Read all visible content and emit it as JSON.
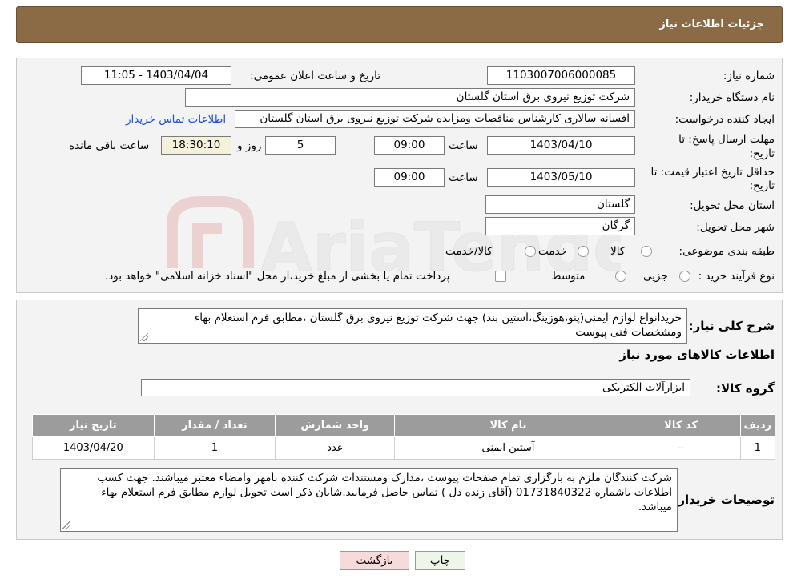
{
  "page_title": "جزئیات اطلاعات نیاز",
  "form": {
    "need_number_label": "شماره نیاز:",
    "need_number": "1103007006000085",
    "announce_label": "تاریخ و ساعت اعلان عمومی:",
    "announce_value": "1403/04/04 - 11:05",
    "buyer_org_label": "نام دستگاه خریدار:",
    "buyer_org": "شرکت توزیع نیروی برق استان گلستان",
    "creator_label": "ایجاد کننده درخواست:",
    "creator": "افسانه سالاری کارشناس مناقصات ومزایده شرکت توزیع نیروی برق استان گلستان",
    "contact_link": "اطلاعات تماس خریدار",
    "deadline_label_1": "مهلت ارسال پاسخ: تا",
    "deadline_label_2": "تاریخ:",
    "deadline_date": "1403/04/10",
    "time_label": "ساعت",
    "deadline_time": "09:00",
    "days_value": "5",
    "days_label": "روز و",
    "remaining_time": "18:30:10",
    "remaining_label": "ساعت باقی مانده",
    "validity_label_1": "حداقل تاریخ اعتبار قیمت: تا",
    "validity_label_2": "تاریخ:",
    "validity_date": "1403/05/10",
    "validity_time": "09:00",
    "province_label": "استان محل تحویل:",
    "province": "گلستان",
    "city_label": "شهر محل تحویل:",
    "city": "گرگان",
    "category_label": "طبقه بندی موضوعی:",
    "category_options": [
      "کالا",
      "خدمت",
      "کالا/خدمت"
    ],
    "purchase_type_label": "نوع فرآیند خرید :",
    "purchase_options": [
      "جزیی",
      "متوسط"
    ],
    "purchase_note": "پرداخت تمام یا بخشی از مبلغ خرید،از محل \"اسناد خزانه اسلامی\" خواهد بود."
  },
  "description": {
    "label": "شرح کلی نیاز:",
    "text": "خریدانواع لوازم ایمنی(پتو،هوزینگ،آستین بند) جهت شرکت توزیع نیروی برق گلستان ،مطابق فرم استعلام بهاء ومشخصات فنی پیوست"
  },
  "goods_section_title": "اطلاعات کالاهای مورد نیاز",
  "goods_group_label": "گروه کالا:",
  "goods_group": "ابزارآلات الکتریکی",
  "table": {
    "headers": [
      "ردیف",
      "کد کالا",
      "نام کالا",
      "واحد شمارش",
      "تعداد / مقدار",
      "تاریخ نیاز"
    ],
    "rows": [
      [
        "1",
        "--",
        "آستین ایمنی",
        "عدد",
        "1",
        "1403/04/20"
      ]
    ]
  },
  "buyer_notes": {
    "label": "توضیحات خریدار:",
    "text": "شرکت کنندگان ملزم به بارگزاری تمام صفحات پیوست ،مدارک ومستندات شرکت کننده بامهر وامضاء معتبر میباشند. جهت کسب اطلاعات باشماره 01731840322 (آقای زنده دل ) تماس حاصل فرمایید.شایان ذکر است تحویل لوازم مطابق فرم استعلام بهاء میباشد."
  },
  "buttons": {
    "print": "چاپ",
    "back": "بازگشت"
  },
  "watermark": "AriaTender.neT",
  "colors": {
    "header": "#8b6b45",
    "link": "#1a4fd6",
    "table_header": "#9c9c9c",
    "back_button": "#f7dada"
  }
}
